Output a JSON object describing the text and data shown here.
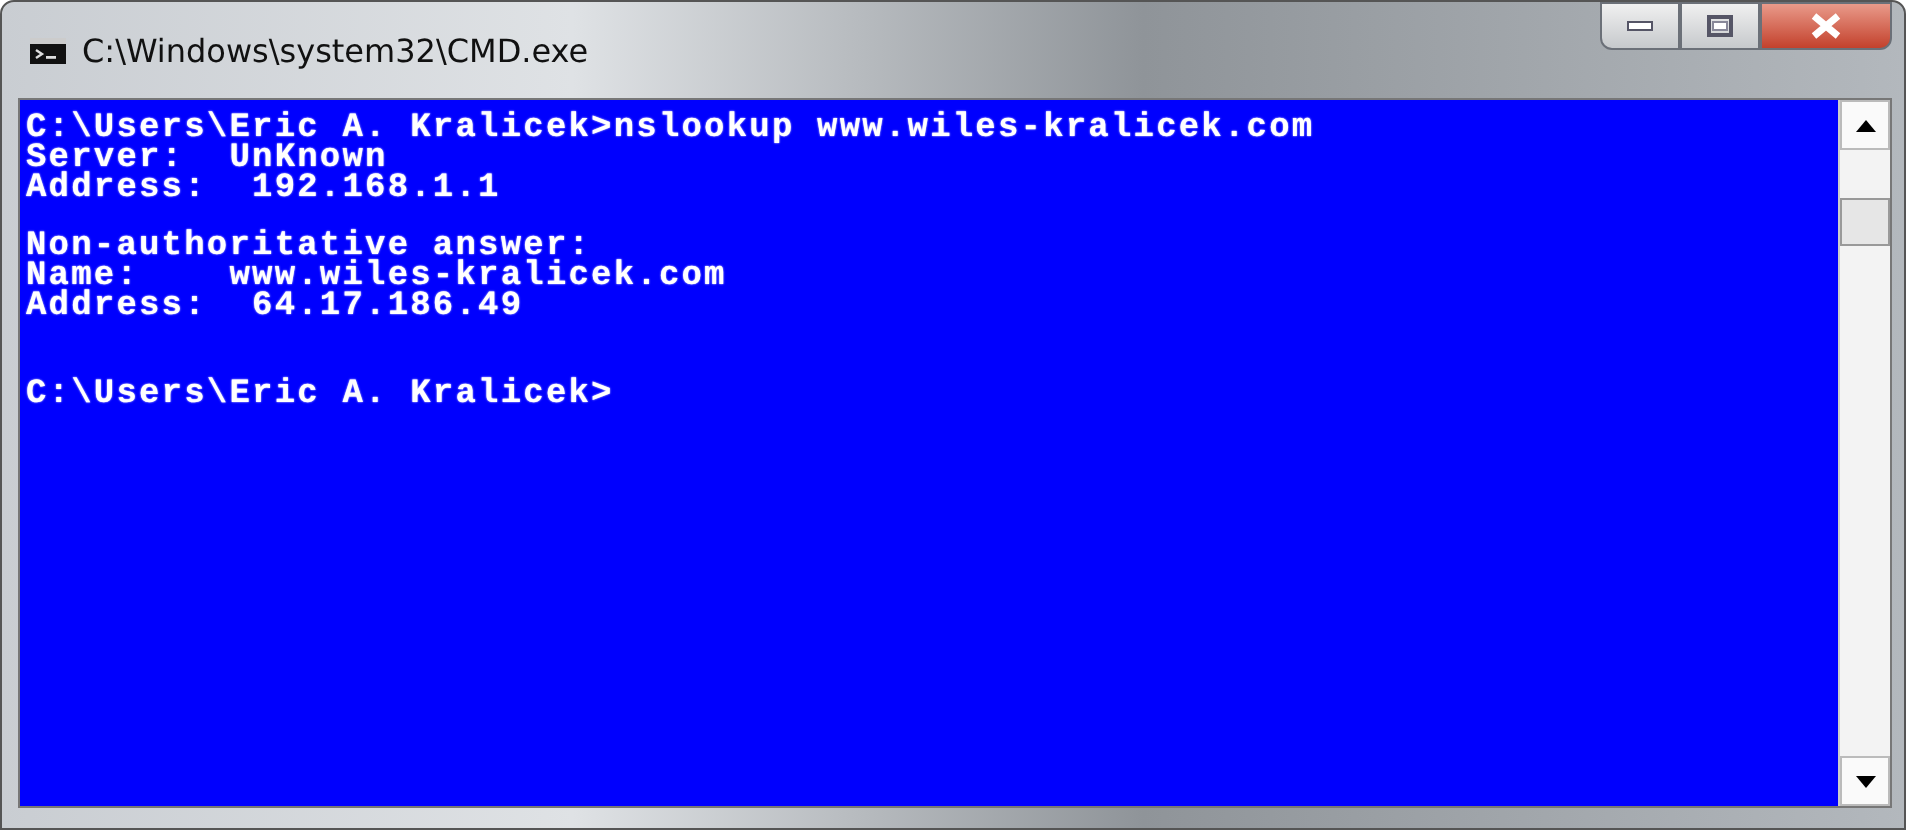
{
  "window": {
    "title": "C:\\Windows\\system32\\CMD.exe"
  },
  "console": {
    "lines": [
      {
        "kind": "text",
        "text": "C:\\Users\\Eric A. Kralicek>nslookup www.wiles-kralicek.com"
      },
      {
        "kind": "text",
        "text": "Server:  UnKnown"
      },
      {
        "kind": "text",
        "text": "Address:  192.168.1.1"
      },
      {
        "kind": "blank"
      },
      {
        "kind": "text",
        "text": "Non-authoritative answer:"
      },
      {
        "kind": "text",
        "text": "Name:    www.wiles-kralicek.com"
      },
      {
        "kind": "text",
        "text": "Address:  64.17.186.49"
      },
      {
        "kind": "blank"
      },
      {
        "kind": "blank"
      },
      {
        "kind": "text",
        "text": "C:\\Users\\Eric A. Kralicek>"
      }
    ]
  }
}
